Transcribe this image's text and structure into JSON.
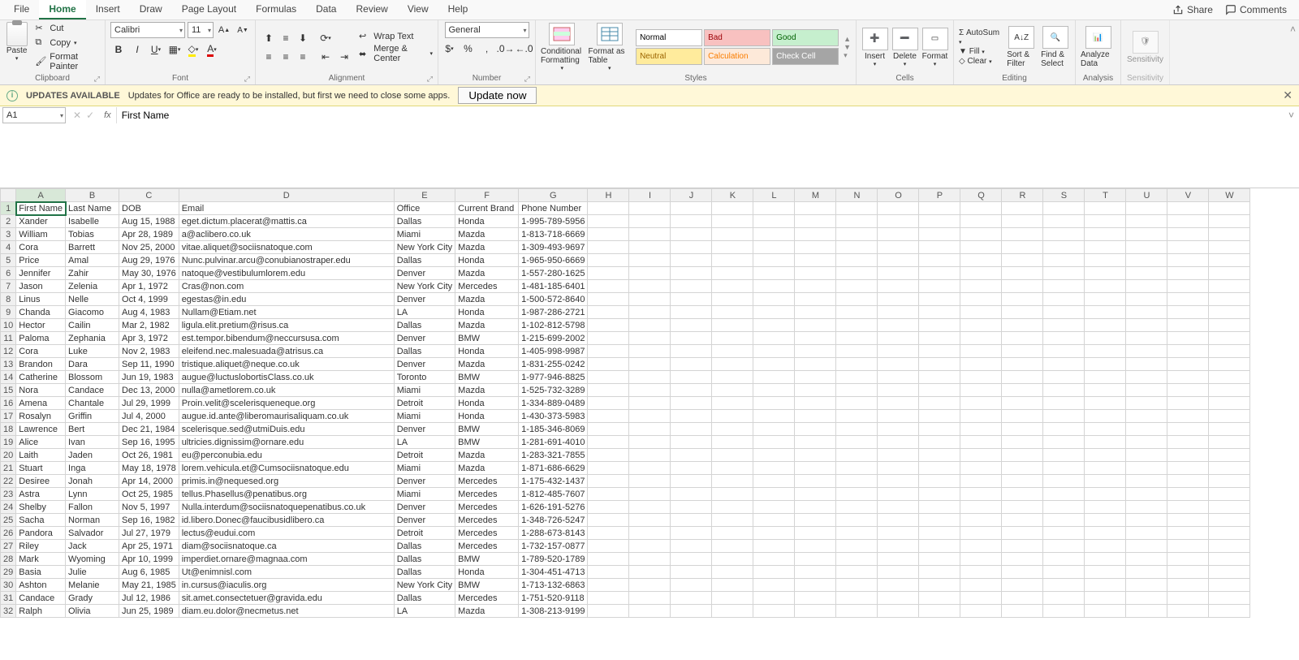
{
  "menu": {
    "tabs": [
      "File",
      "Home",
      "Insert",
      "Draw",
      "Page Layout",
      "Formulas",
      "Data",
      "Review",
      "View",
      "Help"
    ],
    "active": "Home",
    "share": "Share",
    "comments": "Comments"
  },
  "ribbon": {
    "clipboard": {
      "label": "Clipboard",
      "paste": "Paste",
      "cut": "Cut",
      "copy": "Copy",
      "painter": "Format Painter"
    },
    "font": {
      "label": "Font",
      "name": "Calibri",
      "size": "11"
    },
    "alignment": {
      "label": "Alignment",
      "wrap": "Wrap Text",
      "merge": "Merge & Center"
    },
    "number": {
      "label": "Number",
      "format": "General"
    },
    "styles": {
      "label": "Styles",
      "cond": "Conditional Formatting",
      "table": "Format as Table",
      "gallery": [
        {
          "text": "Normal",
          "bg": "#ffffff",
          "fg": "#000"
        },
        {
          "text": "Bad",
          "bg": "#f8c1c0",
          "fg": "#9c0006"
        },
        {
          "text": "Good",
          "bg": "#c6efce",
          "fg": "#006100"
        },
        {
          "text": "Neutral",
          "bg": "#ffeb9c",
          "fg": "#9c6500"
        },
        {
          "text": "Calculation",
          "bg": "#fde9d9",
          "fg": "#fa7d00"
        },
        {
          "text": "Check Cell",
          "bg": "#a5a5a5",
          "fg": "#ffffff"
        }
      ]
    },
    "cells": {
      "label": "Cells",
      "insert": "Insert",
      "delete": "Delete",
      "format": "Format"
    },
    "editing": {
      "label": "Editing",
      "autosum": "AutoSum",
      "fill": "Fill",
      "clear": "Clear",
      "sort": "Sort & Filter",
      "find": "Find & Select"
    },
    "analyze": {
      "label": "Analysis",
      "btn": "Analyze Data"
    },
    "sensitivity": {
      "label": "Sensitivity",
      "btn": "Sensitivity"
    }
  },
  "updates": {
    "title": "UPDATES AVAILABLE",
    "msg": "Updates for Office are ready to be installed, but first we need to close some apps.",
    "btn": "Update now"
  },
  "namebox": "A1",
  "formula": "First Name",
  "columns": [
    "A",
    "B",
    "C",
    "D",
    "E",
    "F",
    "G",
    "H",
    "I",
    "J",
    "K",
    "L",
    "M",
    "N",
    "O",
    "P",
    "Q",
    "R",
    "S",
    "T",
    "U",
    "V",
    "W"
  ],
  "selected": {
    "row": 1,
    "col": "A"
  },
  "headers": [
    "First Name",
    "Last Name",
    "DOB",
    "Email",
    "Office",
    "Current Brand",
    "Phone Number"
  ],
  "rows": [
    [
      "Xander",
      "Isabelle",
      "Aug 15, 1988",
      "eget.dictum.placerat@mattis.ca",
      "Dallas",
      "Honda",
      "1-995-789-5956"
    ],
    [
      "William",
      "Tobias",
      "Apr 28, 1989",
      "a@aclibero.co.uk",
      "Miami",
      "Mazda",
      "1-813-718-6669"
    ],
    [
      "Cora",
      "Barrett",
      "Nov 25, 2000",
      "vitae.aliquet@sociisnatoque.com",
      "New York City",
      "Mazda",
      "1-309-493-9697"
    ],
    [
      "Price",
      "Amal",
      "Aug 29, 1976",
      "Nunc.pulvinar.arcu@conubianostraper.edu",
      "Dallas",
      "Honda",
      "1-965-950-6669"
    ],
    [
      "Jennifer",
      "Zahir",
      "May 30, 1976",
      "natoque@vestibulumlorem.edu",
      "Denver",
      "Mazda",
      "1-557-280-1625"
    ],
    [
      "Jason",
      "Zelenia",
      "Apr 1, 1972",
      "Cras@non.com",
      "New York City",
      "Mercedes",
      "1-481-185-6401"
    ],
    [
      "Linus",
      "Nelle",
      "Oct 4, 1999",
      "egestas@in.edu",
      "Denver",
      "Mazda",
      "1-500-572-8640"
    ],
    [
      "Chanda",
      "Giacomo",
      "Aug 4, 1983",
      "Nullam@Etiam.net",
      "LA",
      "Honda",
      "1-987-286-2721"
    ],
    [
      "Hector",
      "Cailin",
      "Mar 2, 1982",
      "ligula.elit.pretium@risus.ca",
      "Dallas",
      "Mazda",
      "1-102-812-5798"
    ],
    [
      "Paloma",
      "Zephania",
      "Apr 3, 1972",
      "est.tempor.bibendum@neccursusa.com",
      "Denver",
      "BMW",
      "1-215-699-2002"
    ],
    [
      "Cora",
      "Luke",
      "Nov 2, 1983",
      "eleifend.nec.malesuada@atrisus.ca",
      "Dallas",
      "Honda",
      "1-405-998-9987"
    ],
    [
      "Brandon",
      "Dara",
      "Sep 11, 1990",
      "tristique.aliquet@neque.co.uk",
      "Denver",
      "Mazda",
      "1-831-255-0242"
    ],
    [
      "Catherine",
      "Blossom",
      "Jun 19, 1983",
      "augue@luctuslobortisClass.co.uk",
      "Toronto",
      "BMW",
      "1-977-946-8825"
    ],
    [
      "Nora",
      "Candace",
      "Dec 13, 2000",
      "nulla@ametlorem.co.uk",
      "Miami",
      "Mazda",
      "1-525-732-3289"
    ],
    [
      "Amena",
      "Chantale",
      "Jul 29, 1999",
      "Proin.velit@scelerisqueneque.org",
      "Detroit",
      "Honda",
      "1-334-889-0489"
    ],
    [
      "Rosalyn",
      "Griffin",
      "Jul 4, 2000",
      "augue.id.ante@liberomaurisaliquam.co.uk",
      "Miami",
      "Honda",
      "1-430-373-5983"
    ],
    [
      "Lawrence",
      "Bert",
      "Dec 21, 1984",
      "scelerisque.sed@utmiDuis.edu",
      "Denver",
      "BMW",
      "1-185-346-8069"
    ],
    [
      "Alice",
      "Ivan",
      "Sep 16, 1995",
      "ultricies.dignissim@ornare.edu",
      "LA",
      "BMW",
      "1-281-691-4010"
    ],
    [
      "Laith",
      "Jaden",
      "Oct 26, 1981",
      "eu@perconubia.edu",
      "Detroit",
      "Mazda",
      "1-283-321-7855"
    ],
    [
      "Stuart",
      "Inga",
      "May 18, 1978",
      "lorem.vehicula.et@Cumsociisnatoque.edu",
      "Miami",
      "Mazda",
      "1-871-686-6629"
    ],
    [
      "Desiree",
      "Jonah",
      "Apr 14, 2000",
      "primis.in@nequesed.org",
      "Denver",
      "Mercedes",
      "1-175-432-1437"
    ],
    [
      "Astra",
      "Lynn",
      "Oct 25, 1985",
      "tellus.Phasellus@penatibus.org",
      "Miami",
      "Mercedes",
      "1-812-485-7607"
    ],
    [
      "Shelby",
      "Fallon",
      "Nov 5, 1997",
      "Nulla.interdum@sociisnatoquepenatibus.co.uk",
      "Denver",
      "Mercedes",
      "1-626-191-5276"
    ],
    [
      "Sacha",
      "Norman",
      "Sep 16, 1982",
      "id.libero.Donec@faucibusidlibero.ca",
      "Denver",
      "Mercedes",
      "1-348-726-5247"
    ],
    [
      "Pandora",
      "Salvador",
      "Jul 27, 1979",
      "lectus@eudui.com",
      "Detroit",
      "Mercedes",
      "1-288-673-8143"
    ],
    [
      "Riley",
      "Jack",
      "Apr 25, 1971",
      "diam@sociisnatoque.ca",
      "Dallas",
      "Mercedes",
      "1-732-157-0877"
    ],
    [
      "Mark",
      "Wyoming",
      "Apr 10, 1999",
      "imperdiet.ornare@magnaa.com",
      "Dallas",
      "BMW",
      "1-789-520-1789"
    ],
    [
      "Basia",
      "Julie",
      "Aug 6, 1985",
      "Ut@enimnisl.com",
      "Dallas",
      "Honda",
      "1-304-451-4713"
    ],
    [
      "Ashton",
      "Melanie",
      "May 21, 1985",
      "in.cursus@iaculis.org",
      "New York City",
      "BMW",
      "1-713-132-6863"
    ],
    [
      "Candace",
      "Grady",
      "Jul 12, 1986",
      "sit.amet.consectetuer@gravida.edu",
      "Dallas",
      "Mercedes",
      "1-751-520-9118"
    ],
    [
      "Ralph",
      "Olivia",
      "Jun 25, 1989",
      "diam.eu.dolor@necmetus.net",
      "LA",
      "Mazda",
      "1-308-213-9199"
    ]
  ]
}
